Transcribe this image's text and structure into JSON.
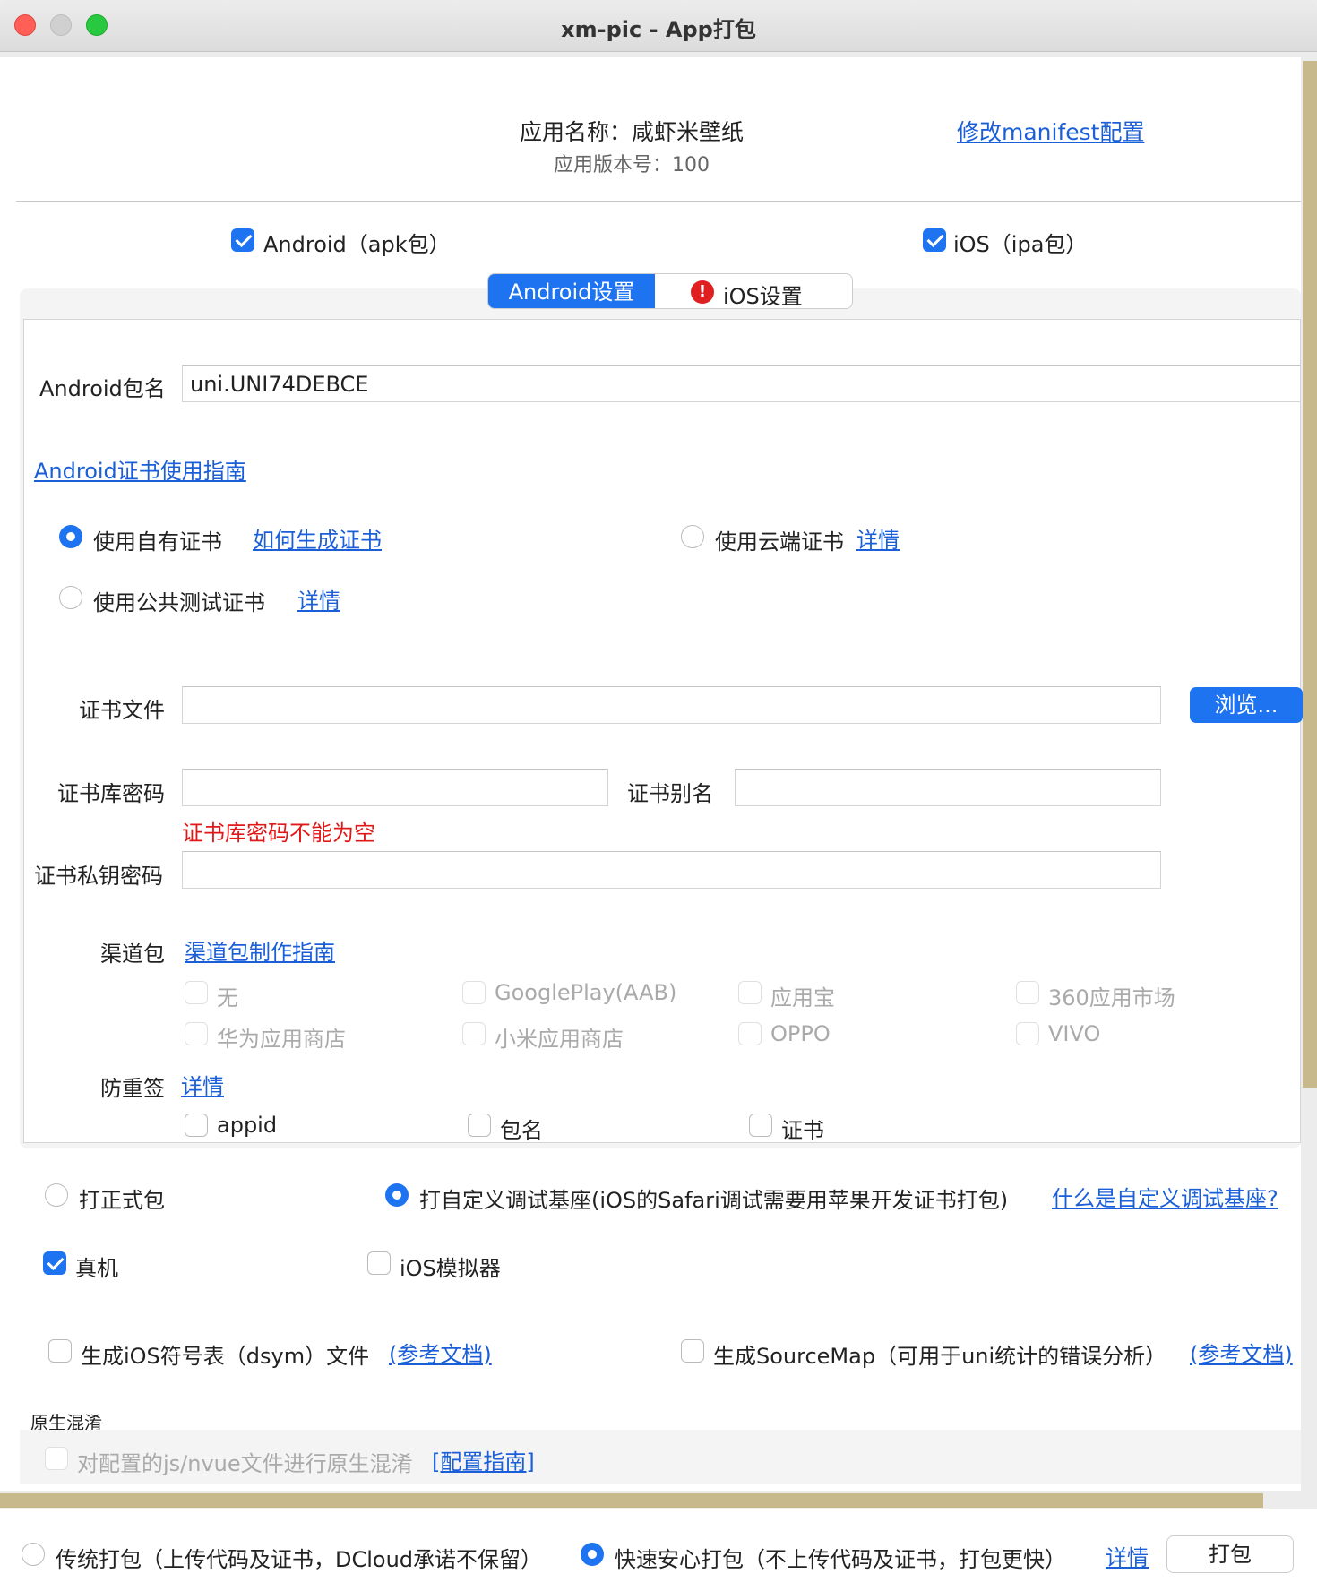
{
  "window": {
    "title": "xm-pic - App打包"
  },
  "app": {
    "name_label": "应用名称：咸虾米壁纸",
    "version_label": "应用版本号：100",
    "manifest_link": "修改manifest配置"
  },
  "platforms": {
    "android": {
      "label": "Android（apk包）",
      "checked": true
    },
    "ios": {
      "label": "iOS（ipa包）",
      "checked": true
    }
  },
  "tabs": [
    {
      "label": "Android设置",
      "active": true
    },
    {
      "label": "iOS设置",
      "active": false,
      "error": true,
      "error_glyph": "!"
    }
  ],
  "android": {
    "package_label": "Android包名",
    "package_value": "uni.UNI74DEBCE",
    "cert_guide_link": "Android证书使用指南",
    "cert_options": {
      "own": {
        "label": "使用自有证书",
        "link": "如何生成证书",
        "selected": true
      },
      "cloud": {
        "label": "使用云端证书",
        "link": "详情",
        "selected": false
      },
      "public": {
        "label": "使用公共测试证书",
        "link": "详情",
        "selected": false
      }
    },
    "cert_file_label": "证书文件",
    "cert_file_value": "",
    "browse_button": "浏览...",
    "keystore_password_label": "证书库密码",
    "keystore_password_value": "",
    "alias_label": "证书别名",
    "alias_value": "",
    "keystore_error": "证书库密码不能为空",
    "private_key_password_label": "证书私钥密码",
    "private_key_password_value": "",
    "channel_label": "渠道包",
    "channel_link": "渠道包制作指南",
    "channels": [
      "无",
      "GooglePlay(AAB)",
      "应用宝",
      "360应用市场",
      "华为应用商店",
      "小米应用商店",
      "OPPO",
      "VIVO"
    ],
    "anti_resign_label": "防重签",
    "anti_resign_link": "详情",
    "anti_resign_options": [
      "appid",
      "包名",
      "证书"
    ]
  },
  "build_type": {
    "release": {
      "label": "打正式包",
      "selected": false
    },
    "custom_base": {
      "label": "打自定义调试基座(iOS的Safari调试需要用苹果开发证书打包)",
      "selected": true
    },
    "custom_base_link": "什么是自定义调试基座?"
  },
  "targets": {
    "device": {
      "label": "真机",
      "checked": true
    },
    "simulator": {
      "label": "iOS模拟器",
      "checked": false
    }
  },
  "options": {
    "dsym": {
      "label": "生成iOS符号表（dsym）文件",
      "link": "(参考文档)",
      "checked": false
    },
    "sourcemap": {
      "label": "生成SourceMap（可用于uni统计的错误分析）",
      "link": "(参考文档)",
      "checked": false
    }
  },
  "obfuscation": {
    "section_label": "原生混淆",
    "option_label": "对配置的js/nvue文件进行原生混淆",
    "link": "[配置指南]"
  },
  "footer": {
    "traditional": {
      "label": "传统打包（上传代码及证书，DCloud承诺不保留）",
      "selected": false
    },
    "fast": {
      "label": "快速安心打包（不上传代码及证书，打包更快）",
      "selected": true
    },
    "details_link": "详情",
    "pack_button": "打包"
  }
}
